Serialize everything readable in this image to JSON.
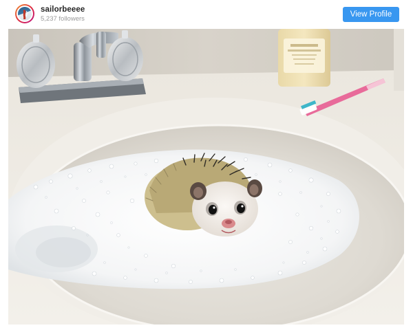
{
  "profile": {
    "username": "sailorbeeee",
    "followers": "5,237 followers",
    "avatar_icon": "profile-avatar"
  },
  "actions": {
    "view_profile_label": "View Profile",
    "accent_color": "#3897f0"
  },
  "photo": {
    "icon": "hedgehog-photo"
  }
}
